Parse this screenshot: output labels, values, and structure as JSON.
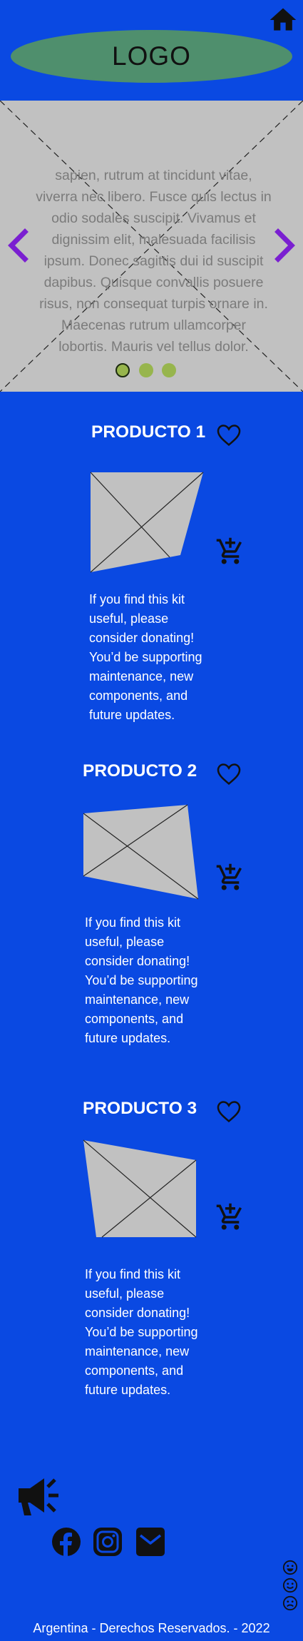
{
  "header": {
    "logo": "LOGO"
  },
  "carousel": {
    "text_lines": [
      "sapien, rutrum at tincidunt vitae,",
      "viverra nec libero. Fusce quis lectus in",
      "odio sodales suscipit. Vivamus et",
      "dignissim elit, malesuada facilisis",
      "ipsum. Donec sagittis dui id suscipit",
      "dapibus. Quisque convallis posuere",
      "risus, non consequat turpis ornare in.",
      "Maecenas rutrum ullamcorper",
      "lobortis. Mauris vel tellus dolor."
    ],
    "dots_count": 3,
    "active_dot": 1
  },
  "products": [
    {
      "title": "PRODUCTO 1",
      "description_lines": [
        "If you find this kit",
        "useful, please",
        "consider donating!",
        "You’d be supporting",
        "maintenance, new",
        "components, and",
        "future updates."
      ]
    },
    {
      "title": "PRODUCTO 2",
      "description_lines": [
        "If you find this kit",
        "useful, please",
        "consider donating!",
        "You’d be supporting",
        "maintenance, new",
        "components, and",
        "future updates."
      ]
    },
    {
      "title": "PRODUCTO 3",
      "description_lines": [
        "If you find this kit",
        "useful, please",
        "consider donating!",
        "You’d be supporting",
        "maintenance, new",
        "components, and",
        "future updates."
      ]
    }
  ],
  "icons": {
    "home": "home-icon",
    "arrow_left": "chevron-left-icon",
    "arrow_right": "chevron-right-icon",
    "favorite": "heart-icon",
    "cart": "add-to-cart-icon",
    "megaphone": "megaphone-icon",
    "facebook": "facebook-icon",
    "instagram": "instagram-icon",
    "mail": "mail-icon",
    "emoji_happy": "happy-face-icon",
    "emoji_neutral": "smile-face-icon",
    "emoji_sad": "sad-face-icon"
  },
  "colors": {
    "background": "#0a49e2",
    "logo_ellipse": "#4f8f6d",
    "carousel_bg": "#c1c1c1",
    "carousel_text": "#7b7b7b",
    "arrow": "#7a1fd1",
    "dot": "#97b54d",
    "placeholder": "#c1c1c1"
  },
  "footer": {
    "copyright": "Argentina - Derechos Reservados. - 2022"
  }
}
